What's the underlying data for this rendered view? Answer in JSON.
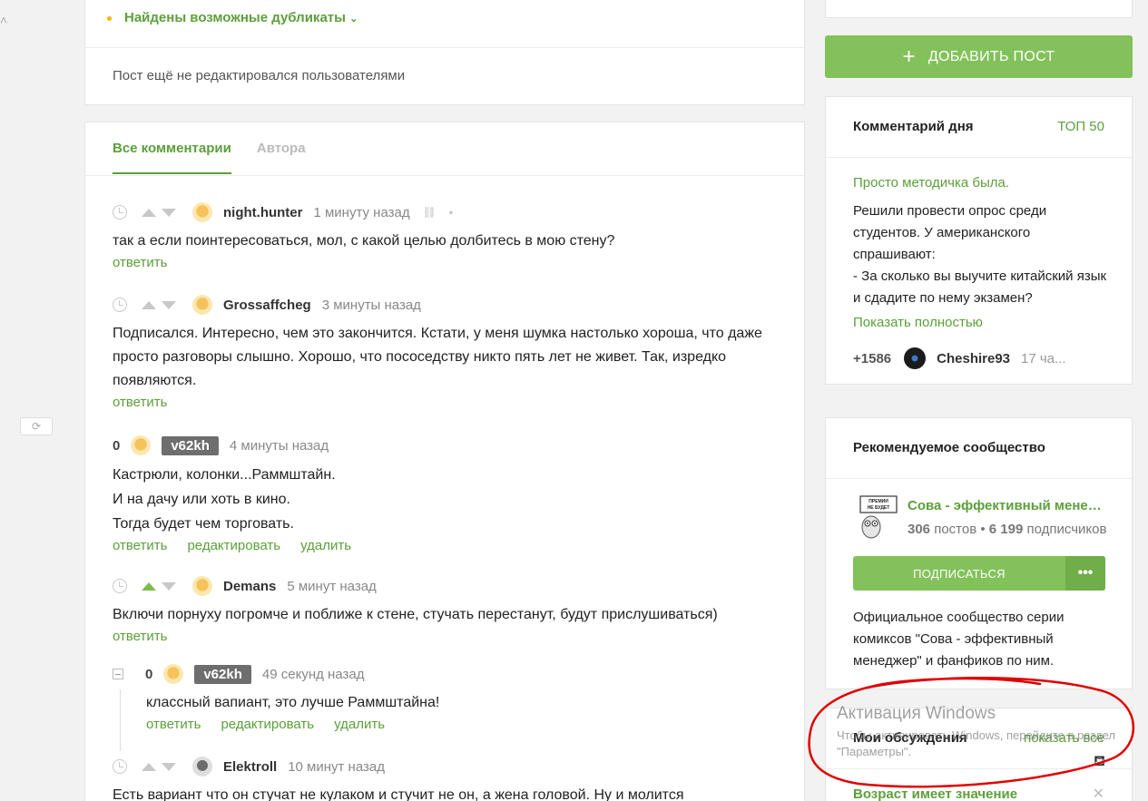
{
  "top_card": {
    "duplicates_label": "Найдены возможные дубликаты",
    "not_edited": "Пост ещё не редактировался пользователями"
  },
  "tabs": [
    {
      "label": "Все комментарии",
      "active": true
    },
    {
      "label": "Автора",
      "active": false
    }
  ],
  "actions": {
    "reply": "ответить",
    "edit": "редактировать",
    "delete": "удалить"
  },
  "comments": [
    {
      "user": "night.hunter",
      "time": "1 минуту назад",
      "text": "так а если поинтересоваться, мол, с какой целью долбитесь в мою стену?"
    },
    {
      "user": "Grossaffcheg",
      "time": "3 минуты назад",
      "text": "Подписался. Интересно, чем это закончится. Кстати, у меня шумка настолько хороша, что даже просто разговоры слышно. Хорошо, что пососедству никто пять лет не живет. Так, изредко появляются."
    },
    {
      "score": "0",
      "user": "v62kh",
      "time": "4 минуты назад",
      "lines": [
        "Кастрюли, колонки...Раммштайн.",
        "И на дачу или хоть в кино.",
        "Тогда будет чем торговать."
      ]
    },
    {
      "user": "Demans",
      "time": "5 минут назад",
      "text": "Включи порнуху погромче и поближе к стене, стучать перестанут, будут прислушиваться)"
    },
    {
      "score": "0",
      "user": "v62kh",
      "time": "49 секунд назад",
      "text": "классный вапиант, это лучше Раммштайна!"
    },
    {
      "user": "Elektroll",
      "time": "10 минут назад",
      "text": "Есть вариант что он стучат не кулаком и стучит не он, а жена головой. Ну и молится"
    }
  ],
  "sidebar": {
    "add_post": "ДОБАВИТЬ ПОСТ",
    "comment_of_day": {
      "title": "Комментарий дня",
      "top_link": "ТОП 50",
      "post_title": "Просто методичка была.",
      "text": "Решили провести опрос среди студентов. У американского спрашивают:\n- За сколько вы выучите китайский язык и сдадите по нему экзамен?",
      "show_more": "Показать полностью",
      "rating": "+1586",
      "author": "Cheshire93",
      "time": "17 ча..."
    },
    "recommended": {
      "title": "Рекомендуемое сообщество",
      "logo_text": "ПРЕМИИ НЕ БУДЕТ",
      "name": "Сова - эффективный менеджер",
      "posts": "306",
      "posts_label": "постов",
      "subs": "6 199",
      "subs_label": "подписчиков",
      "subscribe": "ПОДПИСАТЬСЯ",
      "more": "•••",
      "description": "Официальное сообщество серии комиксов \"Сова - эффективный менеджер\" и фанфиков по ним."
    },
    "my_discussions": {
      "title": "Мои обсуждения",
      "show_all": "показать все",
      "item": "Возраст имеет значение"
    }
  },
  "windows_activation": {
    "title": "Активация Windows",
    "text": "Чтобы активировать Windows, перейдите в раздел \"Параметры\"."
  },
  "icons": {
    "duplicates_chevron": "chevron-down-icon",
    "clock": "clock-icon",
    "link": "link-icon",
    "save": "save-icon",
    "refresh": "refresh-icon",
    "plus": "plus-icon",
    "close": "close-icon",
    "paint": "paint-bucket-icon"
  },
  "colors": {
    "accent": "#5c9f3a",
    "button": "#83c25b",
    "annotation": "#e00000"
  }
}
